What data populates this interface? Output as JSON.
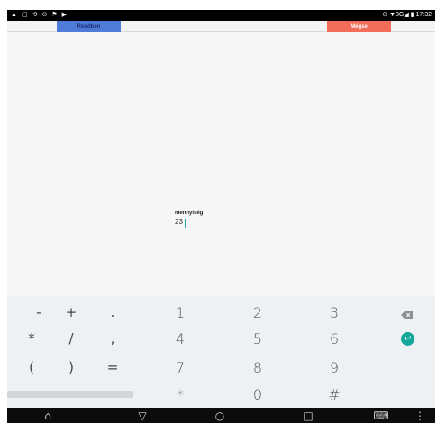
{
  "status_bar": {
    "left_icons": [
      "warning",
      "message",
      "sync",
      "link",
      "flag",
      "media"
    ],
    "right_text": "⊙ ▼3G◢ ▮ 17:32"
  },
  "top_bar": {
    "ok_label": "Rendben",
    "cancel_label": "Mégse"
  },
  "field": {
    "label": "mennyiség",
    "value": "23"
  },
  "keyboard": {
    "rows": [
      [
        "-",
        "+",
        ".",
        "1",
        "2",
        "3"
      ],
      [
        "*",
        "/",
        ",",
        "4",
        "5",
        "6"
      ],
      [
        "(",
        ")",
        "=",
        "7",
        "8",
        "9"
      ],
      [
        "",
        "",
        "",
        "*",
        "0",
        "#"
      ]
    ],
    "enter_glyph": "↩",
    "backspace_icon": "backspace-icon",
    "enter_icon": "enter-icon"
  },
  "nav": {
    "back": "⌂",
    "home": "▽",
    "recents": "○",
    "square": "□",
    "keyboard": "⌨",
    "dots": "⋮"
  },
  "colors": {
    "ok_bg": "#4f7bd8",
    "cancel_bg": "#f26d5a",
    "accent": "#14a89b"
  }
}
